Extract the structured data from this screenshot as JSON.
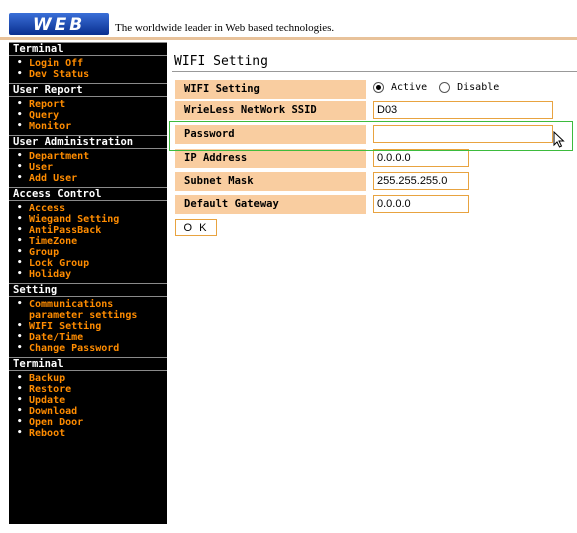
{
  "header": {
    "logo_text": "WEB",
    "tagline": "The worldwide leader in Web based technologies."
  },
  "sidebar": {
    "sections": [
      {
        "title": "Terminal",
        "items": [
          "Login Off",
          "Dev Status"
        ]
      },
      {
        "title": "User Report",
        "items": [
          "Report",
          "Query",
          "Monitor"
        ]
      },
      {
        "title": "User Administration",
        "items": [
          "Department",
          "User",
          "Add User"
        ]
      },
      {
        "title": "Access Control",
        "items": [
          "Access",
          "Wiegand Setting",
          "AntiPassBack",
          "TimeZone",
          "Group",
          "Lock Group",
          "Holiday"
        ]
      },
      {
        "title": "Setting",
        "items": [
          "Communications\nparameter settings",
          "WIFI Setting",
          "Date/Time",
          "Change Password"
        ]
      },
      {
        "title": "Terminal",
        "items": [
          "Backup",
          "Restore",
          "Update",
          "Download",
          "Open Door",
          "Reboot"
        ]
      }
    ]
  },
  "main": {
    "title": "WIFI Setting",
    "fields": {
      "wifi_setting": {
        "label": "WIFI Setting",
        "options": [
          "Active",
          "Disable"
        ],
        "selected": "Active"
      },
      "ssid": {
        "label": "WrieLess NetWork SSID",
        "value": "D03"
      },
      "password": {
        "label": "Password",
        "value": ""
      },
      "ip_address": {
        "label": "IP Address",
        "value": "0.0.0.0"
      },
      "subnet_mask": {
        "label": "Subnet Mask",
        "value": "255.255.255.0"
      },
      "default_gateway": {
        "label": "Default Gateway",
        "value": "0.0.0.0"
      }
    },
    "ok_label": "O K"
  },
  "colors": {
    "label_bg": "#f9cda0",
    "nav_item": "#ff8c00",
    "sidebar_bg": "#000000",
    "input_border": "#e8a340",
    "focus_outline": "#3dbb3d"
  }
}
